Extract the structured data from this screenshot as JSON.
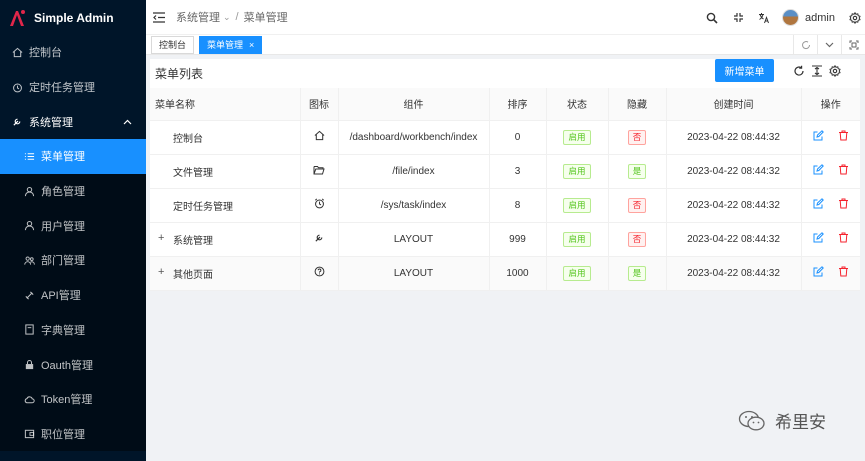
{
  "app": {
    "title": "Simple Admin"
  },
  "sidebar": {
    "items": [
      {
        "label": "控制台",
        "icon": "home-icon"
      },
      {
        "label": "定时任务管理",
        "icon": "clock-icon"
      },
      {
        "label": "系统管理",
        "icon": "wrench-icon",
        "expanded": true
      },
      {
        "label": "菜单管理",
        "icon": "list-icon",
        "active": true
      },
      {
        "label": "角色管理",
        "icon": "user-icon"
      },
      {
        "label": "用户管理",
        "icon": "user-icon"
      },
      {
        "label": "部门管理",
        "icon": "team-icon"
      },
      {
        "label": "API管理",
        "icon": "api-icon"
      },
      {
        "label": "字典管理",
        "icon": "book-icon"
      },
      {
        "label": "Oauth管理",
        "icon": "lock-icon"
      },
      {
        "label": "Token管理",
        "icon": "cloud-icon"
      },
      {
        "label": "职位管理",
        "icon": "wallet-icon"
      }
    ]
  },
  "header": {
    "breadcrumb": [
      "系统管理",
      "菜单管理"
    ],
    "username": "admin"
  },
  "tabs": [
    {
      "label": "控制台",
      "active": false
    },
    {
      "label": "菜单管理",
      "active": true
    }
  ],
  "main": {
    "title": "菜单列表",
    "add_button": "新增菜单",
    "columns": [
      "菜单名称",
      "图标",
      "组件",
      "排序",
      "状态",
      "隐藏",
      "创建时间",
      "操作"
    ],
    "rows": [
      {
        "name": "控制台",
        "icon": "home-icon",
        "component": "/dashboard/workbench/index",
        "sort": "0",
        "status": "启用",
        "hidden": "否",
        "created": "2023-04-22 08:44:32",
        "expandable": false
      },
      {
        "name": "文件管理",
        "icon": "folder-icon",
        "component": "/file/index",
        "sort": "3",
        "status": "启用",
        "hidden": "是",
        "created": "2023-04-22 08:44:32",
        "expandable": false
      },
      {
        "name": "定时任务管理",
        "icon": "clock-icon",
        "component": "/sys/task/index",
        "sort": "8",
        "status": "启用",
        "hidden": "否",
        "created": "2023-04-22 08:44:32",
        "expandable": false
      },
      {
        "name": "系统管理",
        "icon": "wrench-icon",
        "component": "LAYOUT",
        "sort": "999",
        "status": "启用",
        "hidden": "否",
        "created": "2023-04-22 08:44:32",
        "expandable": true
      },
      {
        "name": "其他页面",
        "icon": "question-icon",
        "component": "LAYOUT",
        "sort": "1000",
        "status": "启用",
        "hidden": "是",
        "created": "2023-04-22 08:44:32",
        "expandable": true
      }
    ],
    "expand_symbol": "+"
  },
  "watermark": {
    "text": "希里安"
  },
  "colors": {
    "sidebar_bg": "#001529",
    "primary": "#1890ff",
    "success": "#52c41a",
    "danger": "#f5222d"
  }
}
